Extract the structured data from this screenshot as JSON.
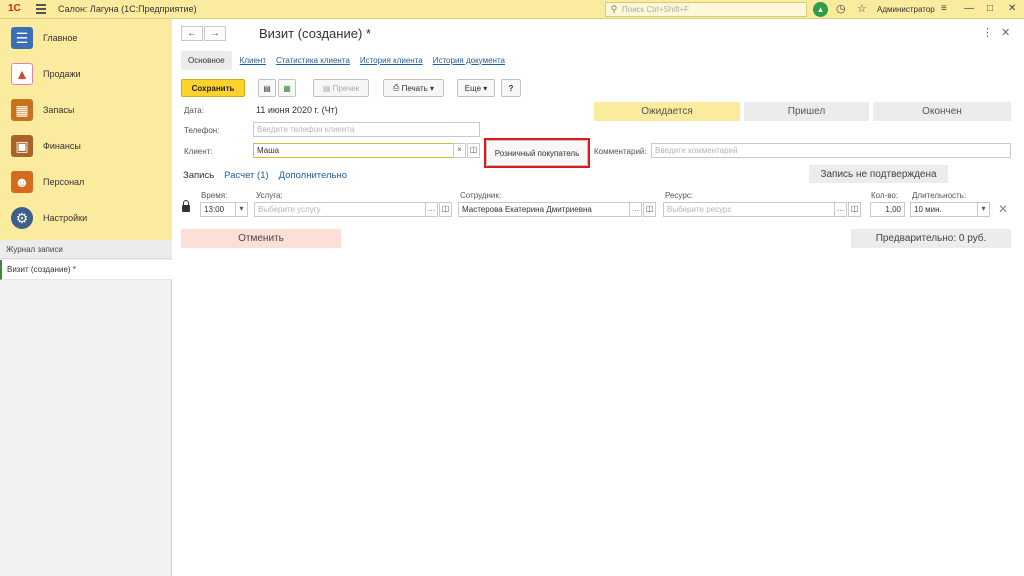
{
  "topbar": {
    "logo": "1С",
    "title": "Салон: Лагуна  (1С:Предприятие)",
    "search_placeholder": "Поиск Ctrl+Shift+F",
    "user": "Администратор"
  },
  "sidebar": {
    "items": [
      {
        "label": "Главное",
        "icon": "clipboard-icon",
        "color": "#3b6fb6"
      },
      {
        "label": "Продажи",
        "icon": "chart-icon",
        "color": "#d24a2a"
      },
      {
        "label": "Запасы",
        "icon": "boxes-icon",
        "color": "#c8731b"
      },
      {
        "label": "Финансы",
        "icon": "wallet-icon",
        "color": "#a9622a"
      },
      {
        "label": "Персонал",
        "icon": "people-icon",
        "color": "#d46b1f"
      },
      {
        "label": "Настройки",
        "icon": "gear-icon",
        "color": "#3e5f8a"
      }
    ],
    "section_title": "Журнал записи",
    "open_windows": [
      "Визит (создание) *"
    ]
  },
  "form": {
    "title": "Визит (создание) *",
    "tabs": [
      "Основное",
      "Клиент",
      "Статистика клиента",
      "История клиента",
      "История документа"
    ],
    "toolbar": {
      "save": "Сохранить",
      "precheck": "Пречек",
      "print": "Печать",
      "more": "Еще",
      "help": "?"
    },
    "date_label": "Дата:",
    "date_value": "11 июня 2020 г. (Чт)",
    "phone_label": "Телефон:",
    "phone_placeholder": "Введите телефон клиента",
    "client_label": "Клиент:",
    "client_value": "Маша",
    "retail_button": "Розничный покупатель",
    "comment_label": "Комментарий:",
    "comment_placeholder": "Введите комментарий",
    "statuses": [
      {
        "label": "Ожидается",
        "active": true
      },
      {
        "label": "Пришел",
        "active": false
      },
      {
        "label": "Окончен",
        "active": false
      }
    ],
    "subtabs": [
      "Запись",
      "Расчет (1)",
      "Дополнительно"
    ],
    "not_confirmed": "Запись не подтверждена",
    "row_labels": {
      "time": "Время:",
      "service": "Услуга:",
      "employee": "Сотрудник:",
      "resource": "Ресурс:",
      "qty": "Кол-во:",
      "duration": "Длительность:"
    },
    "row_values": {
      "time": "13:00",
      "service_placeholder": "Выберите услугу",
      "employee": "Мастерова Екатерина Дмитриевна",
      "resource_placeholder": "Выберите ресурс",
      "qty": "1,00",
      "duration": "10 мин."
    },
    "cancel": "Отменить",
    "preliminary": "Предварительно: 0 руб."
  },
  "colors": {
    "accent_yellow": "#fcd22b",
    "panel_yellow": "#fbeb9f",
    "highlight_red": "#e01818",
    "link_blue": "#1d5fa8"
  }
}
